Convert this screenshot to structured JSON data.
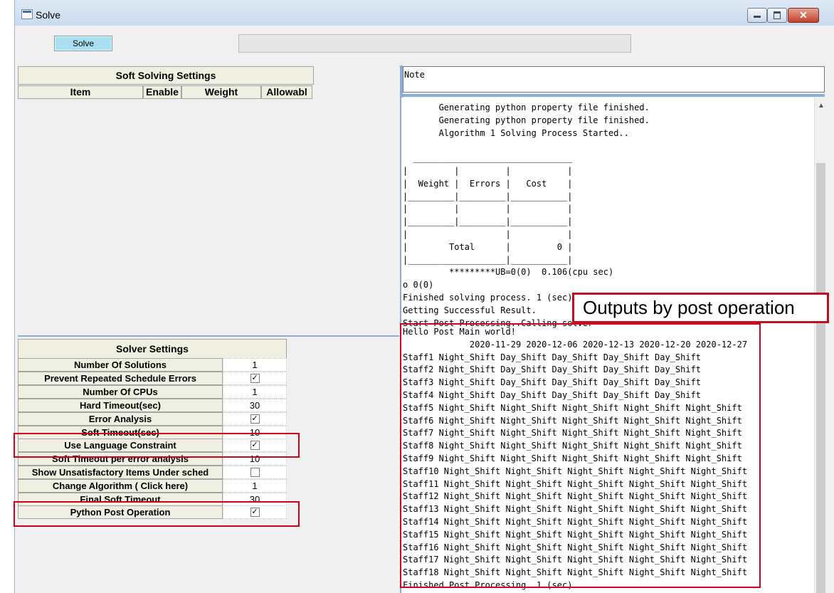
{
  "window": {
    "title": "Solve",
    "close_label": "✕"
  },
  "toolbar": {
    "solve_label": "Solve"
  },
  "soft_solving": {
    "title": "Soft Solving Settings",
    "columns": [
      "Item",
      "Enable",
      "Weight",
      "Allowabl"
    ]
  },
  "solver_settings": {
    "title": "Solver Settings",
    "rows": [
      {
        "label": "Number Of Solutions",
        "value": "1",
        "checkbox": false
      },
      {
        "label": "Prevent Repeated Schedule Errors",
        "value": "✓",
        "checkbox": true
      },
      {
        "label": "Number Of CPUs",
        "value": "1",
        "checkbox": false
      },
      {
        "label": "Hard Timeout(sec)",
        "value": "30",
        "checkbox": false
      },
      {
        "label": "Error Analysis",
        "value": "✓",
        "checkbox": true
      },
      {
        "label": "Soft Timeout(sec)",
        "value": "10",
        "checkbox": false
      },
      {
        "label": "Use Language Constraint",
        "value": "✓",
        "checkbox": true
      },
      {
        "label": "Soft Timeout per error analysis",
        "value": "10",
        "checkbox": false
      },
      {
        "label": "Show Unsatisfactory Items Under sched",
        "value": "",
        "checkbox": true
      },
      {
        "label": "Change Algorithm ( Click here)",
        "value": "1",
        "checkbox": false
      },
      {
        "label": "Final Soft Timeout",
        "value": "30",
        "checkbox": false
      },
      {
        "label": "Python Post Operation",
        "value": "✓",
        "checkbox": true
      }
    ]
  },
  "note": {
    "label": "Note"
  },
  "log": {
    "top": "       Generating python property file finished.\n       Generating python property file finished.\n       Algorithm 1 Solving Process Started..\n\n  _______________________________\n|         |         |           |\n|  Weight |  Errors |   Cost    |\n|_________|_________|___________|\n|         |         |           |\n|_________|_________|___________|\n|                   |           |\n|        Total      |         0 |\n|___________________|___________|\n         *********UB=0(0)  0.106(cpu sec)\no 0(0)\nFinished solving process. 1 (sec)\nGetting Successful Result.\nStart Post Processing..Calling solver",
    "bottom": "Hello Post Main world!\n             2020-11-29 2020-12-06 2020-12-13 2020-12-20 2020-12-27\nStaff1 Night_Shift Day_Shift Day_Shift Day_Shift Day_Shift\nStaff2 Night_Shift Day_Shift Day_Shift Day_Shift Day_Shift\nStaff3 Night_Shift Day_Shift Day_Shift Day_Shift Day_Shift\nStaff4 Night_Shift Day_Shift Day_Shift Day_Shift Day_Shift\nStaff5 Night_Shift Night_Shift Night_Shift Night_Shift Night_Shift\nStaff6 Night_Shift Night_Shift Night_Shift Night_Shift Night_Shift\nStaff7 Night_Shift Night_Shift Night_Shift Night_Shift Night_Shift\nStaff8 Night_Shift Night_Shift Night_Shift Night_Shift Night_Shift\nStaff9 Night_Shift Night_Shift Night_Shift Night_Shift Night_Shift\nStaff10 Night_Shift Night_Shift Night_Shift Night_Shift Night_Shift\nStaff11 Night_Shift Night_Shift Night_Shift Night_Shift Night_Shift\nStaff12 Night_Shift Night_Shift Night_Shift Night_Shift Night_Shift\nStaff13 Night_Shift Night_Shift Night_Shift Night_Shift Night_Shift\nStaff14 Night_Shift Night_Shift Night_Shift Night_Shift Night_Shift\nStaff15 Night_Shift Night_Shift Night_Shift Night_Shift Night_Shift\nStaff16 Night_Shift Night_Shift Night_Shift Night_Shift Night_Shift\nStaff17 Night_Shift Night_Shift Night_Shift Night_Shift Night_Shift\nStaff18 Night_Shift Night_Shift Night_Shift Night_Shift Night_Shift\nFinished Post Processing. 1 (sec)"
  },
  "annotation": {
    "callout": "Outputs by post operation"
  },
  "colors": {
    "highlight": "#d0021b",
    "solve_button": "#a9dff0",
    "pane_separator": "#8aaed6"
  }
}
